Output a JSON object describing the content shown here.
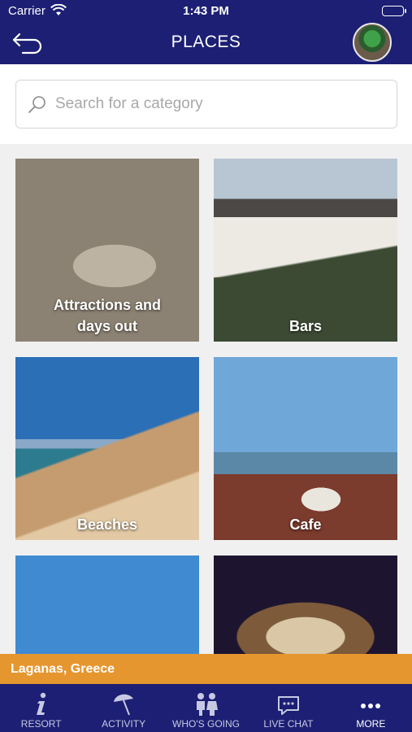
{
  "status_bar": {
    "carrier": "Carrier",
    "time": "1:43 PM"
  },
  "header": {
    "title": "PLACES",
    "back_icon": "back-arrow-icon",
    "color": "#1c1f73"
  },
  "search": {
    "placeholder": "Search for a category",
    "value": ""
  },
  "categories": [
    {
      "label": "Attractions and days out"
    },
    {
      "label": "Bars"
    },
    {
      "label": "Beaches"
    },
    {
      "label": "Cafe"
    },
    {
      "label": ""
    },
    {
      "label": ""
    }
  ],
  "location": {
    "text": "Laganas, Greece",
    "color": "#e6962e"
  },
  "tabs": [
    {
      "label": "RESORT",
      "icon": "info-icon"
    },
    {
      "label": "ACTIVITY",
      "icon": "parasol-icon"
    },
    {
      "label": "WHO'S GOING",
      "icon": "people-icon"
    },
    {
      "label": "LIVE CHAT",
      "icon": "chat-icon"
    },
    {
      "label": "MORE",
      "icon": "more-icon",
      "active": true
    }
  ]
}
